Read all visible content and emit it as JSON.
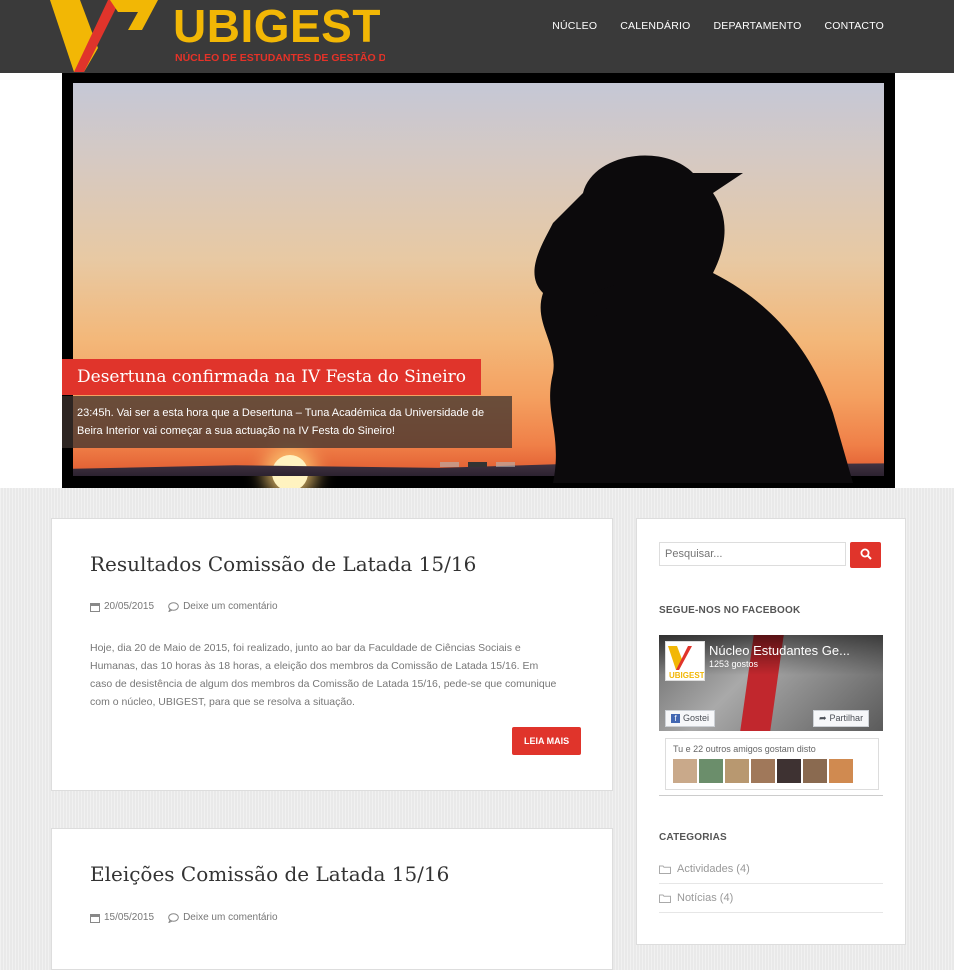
{
  "header": {
    "logo_text": "UBIGEST",
    "logo_subtitle": "NÚCLEO DE ESTUDANTES DE GESTÃO DA UBI",
    "nav": [
      "NÚCLEO",
      "CALENDÁRIO",
      "DEPARTAMENTO",
      "CONTACTO"
    ]
  },
  "slider": {
    "title": "Desertuna confirmada na IV Festa do Sineiro",
    "caption": "23:45h. Vai ser a esta hora que a Desertuna – Tuna Académica da Universidade de Beira Interior vai começar a sua actuação na IV Festa do Sineiro!",
    "dots_count": 3,
    "active_dot": 2
  },
  "posts": [
    {
      "title": "Resultados Comissão de Latada 15/16",
      "date": "20/05/2015",
      "comment_link": "Deixe um comentário",
      "excerpt": "Hoje, dia 20 de Maio de 2015, foi realizado, junto ao bar da Faculdade de Ciências Sociais e Humanas, das 10 horas às 18 horas, a eleição dos membros da Comissão de Latada 15/16. Em caso de desistência de algum dos membros da Comissão de Latada 15/16, pede-se que comunique com o núcleo, UBIGEST, para que se resolva a situação.",
      "read_more": "LEIA MAIS"
    },
    {
      "title": "Eleições Comissão de Latada 15/16",
      "date": "15/05/2015",
      "comment_link": "Deixe um comentário"
    }
  ],
  "sidebar": {
    "search_placeholder": "Pesquisar...",
    "facebook_title": "SEGUE-NOS NO FACEBOOK",
    "facebook": {
      "page_name": "Núcleo Estudantes Ge...",
      "likes": "1253 gostos",
      "like_button": "Gostei",
      "share_button": "Partilhar",
      "friends_text": "Tu e 22 outros amigos gostam disto",
      "logo_text": "UBIGEST"
    },
    "categories_title": "CATEGORIAS",
    "categories": [
      {
        "label": "Actividades (4)"
      },
      {
        "label": "Notícias (4)"
      }
    ]
  },
  "colors": {
    "accent_red": "#e0342b",
    "logo_yellow": "#f2b705",
    "header_bg": "#3a3a3a"
  }
}
